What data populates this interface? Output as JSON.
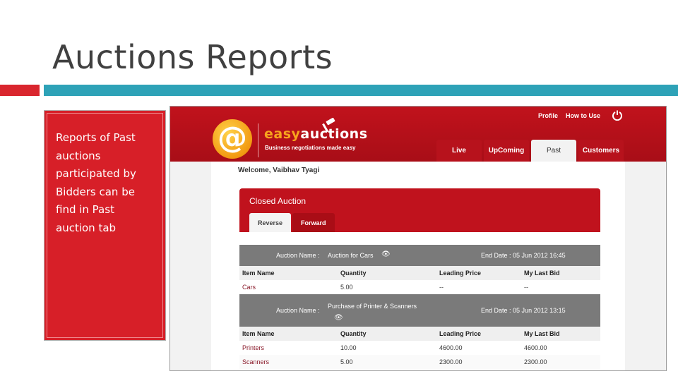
{
  "slide": {
    "title": "Auctions Reports",
    "note": "Reports of Past auctions participated by Bidders can be find in Past auction tab",
    "colors": {
      "accent_red": "#d9262e",
      "accent_teal": "#2ea2b7"
    }
  },
  "app": {
    "logo_icon": "at-sign-logo",
    "brand_part1": "easy",
    "brand_part2": "auctions",
    "tagline": "Business negotiations made easy",
    "header_links": {
      "profile": "Profile",
      "how_to_use": "How to Use"
    },
    "power_icon": "power-icon",
    "tabs": [
      {
        "label": "Live",
        "active": false
      },
      {
        "label": "UpComing",
        "active": false
      },
      {
        "label": "Past",
        "active": true
      },
      {
        "label": "Customers",
        "active": false
      }
    ],
    "welcome": "Welcome, Vaibhav Tyagi",
    "panel": {
      "title": "Closed Auction",
      "sub_tabs": [
        {
          "label": "Reverse",
          "active": true
        },
        {
          "label": "Forward",
          "active": false
        }
      ]
    },
    "columns": [
      "Item Name",
      "Quantity",
      "Leading Price",
      "My Last Bid"
    ],
    "auctions": [
      {
        "name_label": "Auction Name :",
        "name": "Auction for Cars",
        "end_label": "End Date :",
        "end_date": "05 Jun 2012 16:45",
        "rows": [
          [
            "Cars",
            "5.00",
            "--",
            "--"
          ]
        ]
      },
      {
        "name_label": "Auction Name :",
        "name": "Purchase of Printer & Scanners",
        "end_label": "End Date :",
        "end_date": "05 Jun 2012 13:15",
        "rows": [
          [
            "Printers",
            "10.00",
            "4600.00",
            "4600.00"
          ],
          [
            "Scanners",
            "5.00",
            "2300.00",
            "2300.00"
          ]
        ]
      }
    ]
  }
}
